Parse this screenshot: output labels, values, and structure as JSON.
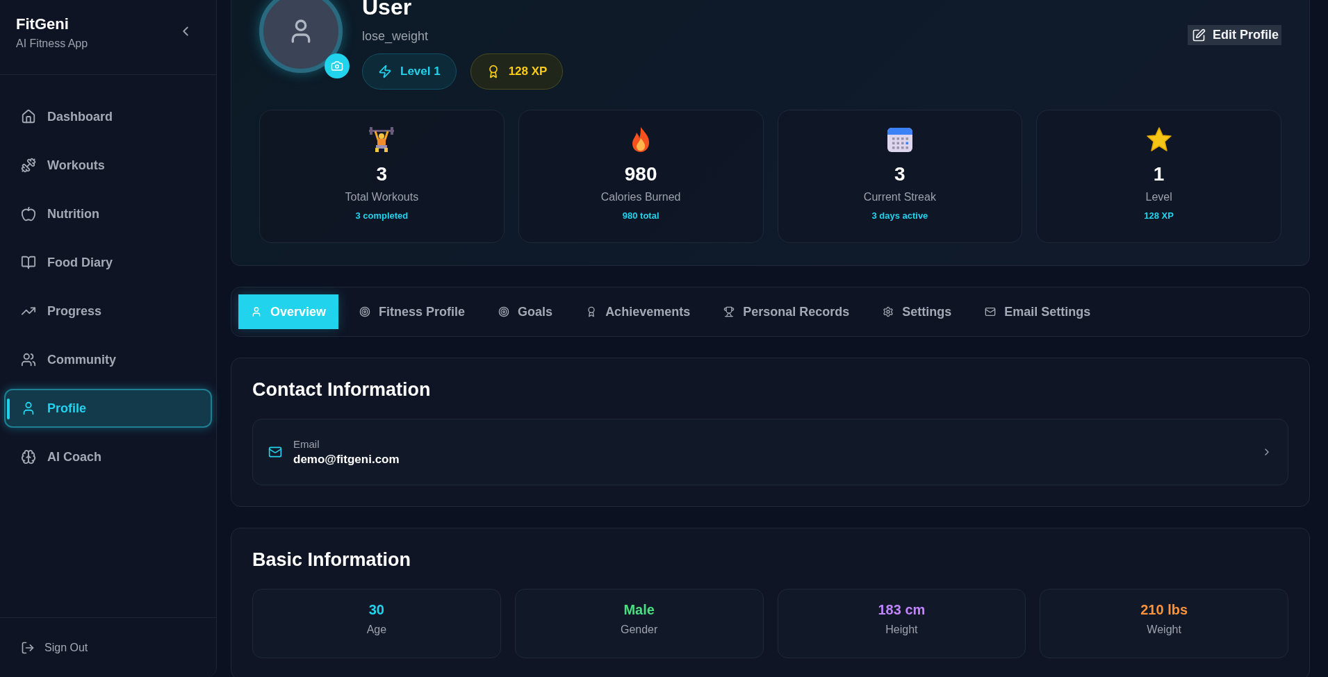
{
  "sidebar": {
    "brand": "FitGeni",
    "tagline": "AI Fitness App",
    "items": [
      {
        "label": "Dashboard",
        "selected": false
      },
      {
        "label": "Workouts",
        "selected": false
      },
      {
        "label": "Nutrition",
        "selected": false
      },
      {
        "label": "Food Diary",
        "selected": false
      },
      {
        "label": "Progress",
        "selected": false
      },
      {
        "label": "Community",
        "selected": false
      },
      {
        "label": "Profile",
        "selected": true
      },
      {
        "label": "AI Coach",
        "selected": false
      }
    ],
    "sign_out": "Sign Out"
  },
  "profile": {
    "name": "User",
    "goal": "lose_weight",
    "edit_button": "Edit Profile",
    "badges": [
      {
        "kind": "level",
        "label": "Level 1"
      },
      {
        "kind": "xp",
        "label": "128 XP"
      }
    ],
    "stats": [
      {
        "value": "3",
        "label": "Total Workouts",
        "detail": "3 completed"
      },
      {
        "value": "980",
        "label": "Calories Burned",
        "detail": "980 total"
      },
      {
        "value": "3",
        "label": "Current Streak",
        "detail": "3 days active"
      },
      {
        "value": "1",
        "label": "Level",
        "detail": "128 XP"
      }
    ]
  },
  "tabs": [
    {
      "label": "Overview",
      "selected": true
    },
    {
      "label": "Fitness Profile",
      "selected": false
    },
    {
      "label": "Goals",
      "selected": false
    },
    {
      "label": "Achievements",
      "selected": false
    },
    {
      "label": "Personal Records",
      "selected": false
    },
    {
      "label": "Settings",
      "selected": false
    },
    {
      "label": "Email Settings",
      "selected": false
    }
  ],
  "contact": {
    "title": "Contact Information",
    "items": [
      {
        "label": "Email",
        "value": "demo@fitgeni.com"
      }
    ]
  },
  "basic": {
    "title": "Basic Information",
    "items": [
      {
        "value": "30",
        "label": "Age",
        "color": "#22d3ee"
      },
      {
        "value": "Male",
        "label": "Gender",
        "color": "#4ade80"
      },
      {
        "value": "183 cm",
        "label": "Height",
        "color": "#c084fc"
      },
      {
        "value": "210 lbs",
        "label": "Weight",
        "color": "#fb923c"
      }
    ]
  }
}
